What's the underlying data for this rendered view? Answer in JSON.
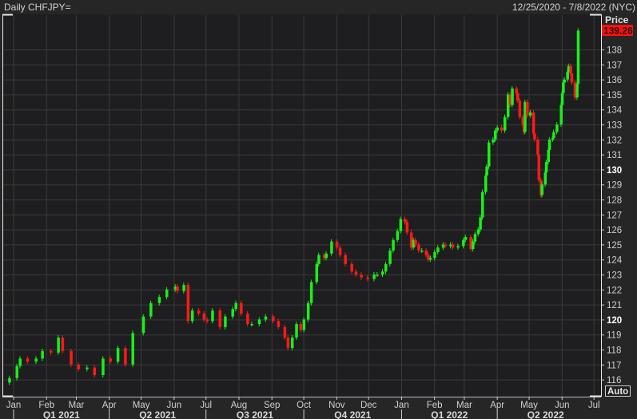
{
  "header": {
    "title": "Daily CHFJPY=",
    "range": "12/25/2020 - 7/8/2022 (NYC)"
  },
  "axis": {
    "price_label": "Price",
    "last_price": "139.26",
    "auto_button": "Auto"
  },
  "colors": {
    "up": "#19f019",
    "down": "#ff1a1a",
    "last_price_bg": "#ff1010",
    "background": "#1e1e20",
    "grid": "#3a3a3a"
  },
  "chart_data": {
    "type": "candlestick",
    "title": "Daily CHFJPY=",
    "ylabel": "Price",
    "ylim": [
      115.5,
      139.8
    ],
    "grid": true,
    "y_ticks": [
      116,
      117,
      118,
      119,
      120,
      121,
      122,
      123,
      124,
      125,
      126,
      127,
      128,
      129,
      130,
      131,
      132,
      133,
      134,
      135,
      136,
      137,
      138
    ],
    "y_ticks_bold": [
      120,
      130
    ],
    "month_labels": [
      {
        "label": "Jan",
        "date": "2021-01-01"
      },
      {
        "label": "Feb",
        "date": "2021-02-01"
      },
      {
        "label": "Mar",
        "date": "2021-03-01"
      },
      {
        "label": "Apr",
        "date": "2021-04-01"
      },
      {
        "label": "May",
        "date": "2021-05-01"
      },
      {
        "label": "Jun",
        "date": "2021-06-01"
      },
      {
        "label": "Jul",
        "date": "2021-07-01"
      },
      {
        "label": "Aug",
        "date": "2021-08-01"
      },
      {
        "label": "Sep",
        "date": "2021-09-01"
      },
      {
        "label": "Oct",
        "date": "2021-10-01"
      },
      {
        "label": "Nov",
        "date": "2021-11-01"
      },
      {
        "label": "Dec",
        "date": "2021-12-01"
      },
      {
        "label": "Jan",
        "date": "2022-01-01"
      },
      {
        "label": "Feb",
        "date": "2022-02-01"
      },
      {
        "label": "Mar",
        "date": "2022-03-01"
      },
      {
        "label": "Apr",
        "date": "2022-04-01"
      },
      {
        "label": "May",
        "date": "2022-05-01"
      },
      {
        "label": "Jun",
        "date": "2022-06-01"
      },
      {
        "label": "Jul",
        "date": "2022-07-01"
      }
    ],
    "quarter_labels": [
      {
        "label": "Q1 2021",
        "start": "2021-01-01",
        "end": "2021-04-01"
      },
      {
        "label": "Q2 2021",
        "start": "2021-04-01",
        "end": "2021-07-01"
      },
      {
        "label": "Q3 2021",
        "start": "2021-07-01",
        "end": "2021-10-01"
      },
      {
        "label": "Q4 2021",
        "start": "2021-10-01",
        "end": "2022-01-01"
      },
      {
        "label": "Q1 2022",
        "start": "2022-01-01",
        "end": "2022-04-01"
      },
      {
        "label": "Q2 2022",
        "start": "2022-04-01",
        "end": "2022-07-01"
      }
    ],
    "series": {
      "dates": [
        "2020-12-28",
        "2021-01-04",
        "2021-01-07",
        "2021-01-14",
        "2021-01-22",
        "2021-01-28",
        "2021-02-05",
        "2021-02-12",
        "2021-02-16",
        "2021-02-24",
        "2021-03-03",
        "2021-03-11",
        "2021-03-18",
        "2021-03-26",
        "2021-04-02",
        "2021-04-09",
        "2021-04-16",
        "2021-04-23",
        "2021-05-03",
        "2021-05-10",
        "2021-05-18",
        "2021-05-25",
        "2021-06-02",
        "2021-06-04",
        "2021-06-10",
        "2021-06-14",
        "2021-06-18",
        "2021-06-24",
        "2021-06-29",
        "2021-07-02",
        "2021-07-07",
        "2021-07-14",
        "2021-07-19",
        "2021-07-26",
        "2021-07-29",
        "2021-08-03",
        "2021-08-09",
        "2021-08-13",
        "2021-08-20",
        "2021-08-26",
        "2021-09-02",
        "2021-09-07",
        "2021-09-13",
        "2021-09-16",
        "2021-09-20",
        "2021-09-24",
        "2021-09-28",
        "2021-10-01",
        "2021-10-05",
        "2021-10-08",
        "2021-10-13",
        "2021-10-15",
        "2021-10-20",
        "2021-10-22",
        "2021-10-27",
        "2021-11-01",
        "2021-11-04",
        "2021-11-09",
        "2021-11-15",
        "2021-11-19",
        "2021-11-24",
        "2021-11-30",
        "2021-12-06",
        "2021-12-09",
        "2021-12-14",
        "2021-12-17",
        "2021-12-21",
        "2021-12-24",
        "2021-12-28",
        "2021-12-31",
        "2022-01-04",
        "2022-01-06",
        "2022-01-10",
        "2022-01-12",
        "2022-01-14",
        "2022-01-17",
        "2022-01-20",
        "2022-01-24",
        "2022-01-26",
        "2022-01-28",
        "2022-02-01",
        "2022-02-04",
        "2022-02-09",
        "2022-02-11",
        "2022-02-16",
        "2022-02-18",
        "2022-02-23",
        "2022-02-28",
        "2022-03-02",
        "2022-03-07",
        "2022-03-09",
        "2022-03-11",
        "2022-03-14",
        "2022-03-16",
        "2022-03-18",
        "2022-03-21",
        "2022-03-22",
        "2022-03-24",
        "2022-03-28",
        "2022-03-30",
        "2022-04-01",
        "2022-04-05",
        "2022-04-08",
        "2022-04-11",
        "2022-04-13",
        "2022-04-15",
        "2022-04-19",
        "2022-04-20",
        "2022-04-22",
        "2022-04-25",
        "2022-04-26",
        "2022-04-27",
        "2022-04-29",
        "2022-05-02",
        "2022-05-05",
        "2022-05-06",
        "2022-05-09",
        "2022-05-10",
        "2022-05-12",
        "2022-05-13",
        "2022-05-16",
        "2022-05-17",
        "2022-05-19",
        "2022-05-20",
        "2022-05-23",
        "2022-05-24",
        "2022-05-27",
        "2022-05-31",
        "2022-06-01",
        "2022-06-02",
        "2022-06-03",
        "2022-06-06",
        "2022-06-07",
        "2022-06-09",
        "2022-06-10",
        "2022-06-13",
        "2022-06-15",
        "2022-06-16"
      ],
      "close": [
        116.1,
        116.9,
        117.4,
        117.2,
        117.4,
        117.9,
        117.8,
        118.8,
        117.9,
        117.0,
        116.7,
        116.8,
        116.3,
        117.4,
        117.2,
        118.1,
        117.0,
        119.1,
        120.2,
        121.1,
        121.5,
        122.0,
        122.2,
        121.9,
        122.3,
        119.9,
        120.6,
        120.4,
        120.0,
        119.9,
        120.6,
        119.5,
        120.2,
        120.7,
        121.1,
        120.4,
        119.7,
        119.7,
        120.0,
        120.2,
        119.9,
        119.5,
        118.8,
        118.1,
        118.8,
        119.7,
        119.3,
        120.0,
        121.1,
        122.5,
        123.7,
        124.3,
        124.1,
        124.4,
        125.2,
        124.8,
        124.3,
        123.7,
        123.2,
        123.0,
        122.8,
        122.7,
        123.0,
        123.0,
        123.2,
        123.7,
        124.6,
        125.3,
        125.9,
        126.7,
        126.5,
        125.8,
        124.8,
        125.3,
        125.0,
        124.6,
        124.6,
        124.3,
        124.0,
        124.1,
        124.5,
        124.8,
        125.0,
        124.9,
        125.0,
        124.8,
        124.9,
        125.3,
        125.5,
        124.7,
        125.2,
        125.7,
        126.0,
        126.8,
        128.5,
        129.6,
        130.2,
        131.8,
        132.0,
        132.6,
        132.8,
        132.6,
        133.5,
        135.0,
        134.3,
        135.4,
        135.1,
        134.6,
        133.5,
        133.0,
        132.5,
        134.5,
        133.6,
        133.8,
        132.4,
        132.0,
        131.0,
        129.3,
        128.3,
        129.0,
        129.8,
        130.5,
        131.3,
        132.0,
        132.1,
        132.5,
        133.0,
        134.3,
        135.1,
        135.8,
        136.0,
        136.5,
        136.9,
        136.4,
        135.8,
        134.8,
        135.7,
        139.26
      ]
    }
  }
}
